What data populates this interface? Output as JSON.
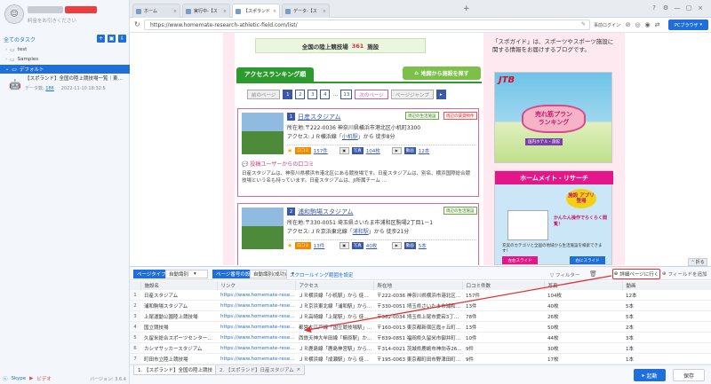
{
  "sidebar": {
    "user_hint": "料金をお引きください",
    "all_tasks": "全てのタスク",
    "folders": [
      "test",
      "Samples",
      "デフォルト"
    ],
    "task": {
      "title": "【スポランド】全国の陸上競技場一覧｜東…",
      "count_label": "データ数:",
      "count": "186",
      "date": "2022-11-10 18:32:5"
    },
    "footer": {
      "skype": "Skype",
      "video": "ビデオ",
      "version": "バージョン: 3.6.4"
    }
  },
  "browser": {
    "tabs": [
      "ホーム",
      "実行中-【ス",
      "【スポランド",
      "データ-【ス"
    ],
    "url": "https://www.homemate-research-athletic-field.com/list/",
    "prelogin": "事前ログイン",
    "pc_browser": "PCブラウザ"
  },
  "page": {
    "count_prefix": "全国の陸上競技場",
    "count_value": "361",
    "count_suffix": "施設",
    "ranking_tab": "アクセスランキング順",
    "map_btn": "地図から施設を探す",
    "pager": {
      "prev": "前のページ",
      "pages": [
        "1",
        "2",
        "3",
        "4"
      ],
      "dots": "…",
      "last": "13",
      "next": "次のページ",
      "jump": "ページジャンプ"
    },
    "cards": [
      {
        "rank": "1",
        "name": "日産スタジアム",
        "addr": "所在地:〒222-0036 神奈川県横浜市港北区小机町3300",
        "access_pre": "アクセス:ＪＲ横浜線「",
        "station": "小机駅",
        "access_post": "」から 徒歩8分",
        "tag1": "周辺の生活施設",
        "tag2": "周辺の賃貸物件",
        "stats": {
          "kuchi": "口コミ",
          "kuchi_val": "157件",
          "photo": "写真",
          "photo_val": "104枚",
          "video": "動画",
          "video_val": "12本"
        },
        "review_head": "投稿ユーザーからの口コミ",
        "review": "日産スタジアムは、神奈川県横浜市港北区にある競技場です。日産スタジアムは、別名、横浜国際総合競技場という名も持っています。日産スタジアムは、JI所属チーム …"
      },
      {
        "rank": "2",
        "name": "浦和駒場スタジアム",
        "addr": "所在地:〒330-0051 埼玉県さいたま市浦和区駒場2丁目1－1",
        "access_pre": "アクセス:ＪＲ京浜東北線「",
        "station": "浦和駅",
        "access_post": "」から 徒歩21分",
        "tag1": "周辺の生活施設",
        "tag2": "",
        "stats": {
          "kuchi": "口コミ",
          "kuchi_val": "13件",
          "photo": "写真",
          "photo_val": "40枚",
          "video": "動画",
          "video_val": "5本"
        },
        "review_head": "",
        "review": ""
      }
    ],
    "ad_text": "「スポガイド」は、スポーツやスポーツ施設に関する情報をお届けするブログです。",
    "jtb": {
      "logo": "JTB",
      "line1": "売れ筋プラン",
      "line2": "ランキング",
      "sub": "国内ホテル・旅館"
    },
    "home": {
      "title": "ホームメイト・リサーチ",
      "app": "施設 アプリ 登場",
      "copy": "かんたん操作でらくらく閲覧！",
      "desc": "充実のカテゴリと全国の地域から生活施設を検索できます！",
      "left": "左右スライド",
      "right": "右にスライド"
    }
  },
  "extract": {
    "collapse": "折る",
    "page_type_label": "ページタイプ",
    "page_type_value": "自動識別",
    "page_num_label": "ページ番号の設定",
    "page_num_value": "自動識別(成功)",
    "scroll_link": "スクロールイング範囲を設定",
    "filter": "フィルター",
    "clear": "クリア",
    "detail": "詳細ページに行く",
    "add_field": "フィールドを追加"
  },
  "table": {
    "columns": [
      "",
      "施設名",
      "リンク",
      "アクセス",
      "所在地",
      "口コミ件数",
      "写真",
      "動画"
    ],
    "rows": [
      [
        "1",
        "日産スタジアム",
        "https://www.homemate-research-ath...",
        "ＪＲ横浜線「小机駅」から 徒歩8分",
        "〒222-0036 神奈川県横浜市港北区小机町3300",
        "157件",
        "104枚",
        "12本"
      ],
      [
        "2",
        "浦和駒場スタジアム",
        "https://www.homemate-research-ath...",
        "ＪＲ京浜東北線「浦和駅」から 徒歩21分",
        "〒330-0051 埼玉県さいたま市浦和区駒場2丁目1－1",
        "13件",
        "40枚",
        "5本"
      ],
      [
        "3",
        "上尾運動公園陸上競技場",
        "https://www.homemate-research-ath...",
        "ＪＲ高崎線「上尾駅」から 徒歩30分",
        "〒362-0034 埼玉県上尾市愛宕3丁目28－1",
        "78件",
        "26枚",
        "5本"
      ],
      [
        "4",
        "国立競技場",
        "https://www.homemate-research-ath...",
        "都営大江戸線「国立競技場駅」から 徒歩1分",
        "〒160-0013 東京都新宿区霞ヶ丘町10－1",
        "13件",
        "50枚",
        "2本"
      ],
      [
        "5",
        "久留米総合スポーツセンター陸上競技場",
        "https://www.homemate-research-ath...",
        "西鉄天神大牟田線「櫛原駅」から 徒歩13分",
        "〒839-0851 福岡県久留米市御井町1710",
        "10件",
        "44枚",
        "3本"
      ],
      [
        "6",
        "カシマサッカースタジアム",
        "https://www.homemate-research-ath...",
        "ＪＲ鹿島線「鹿島神宮駅」から 徒歩4分",
        "〒314-0021 茨城県鹿嶋市神向寺26－2",
        "9件",
        "30枚",
        "1本"
      ],
      [
        "7",
        "町田市立陸上競技場",
        "https://www.homemate-research-ath...",
        "ＪＲ横浜線「成瀬駅」から 徒歩23分",
        "〒195-0063 東京都町田市野津田町2035",
        "9件",
        "17枚",
        "1本"
      ]
    ]
  },
  "bottom": {
    "tab1": "1. 【スポランド】全国の陸上競技",
    "tab2": "2. 【スポランド】日産スタジアム",
    "start": "起動",
    "save": "保存"
  },
  "colors": {
    "accent": "#1e6fd9",
    "highlight": "#e03030",
    "green": "#2c9a2c",
    "pink": "#d86aa0"
  }
}
